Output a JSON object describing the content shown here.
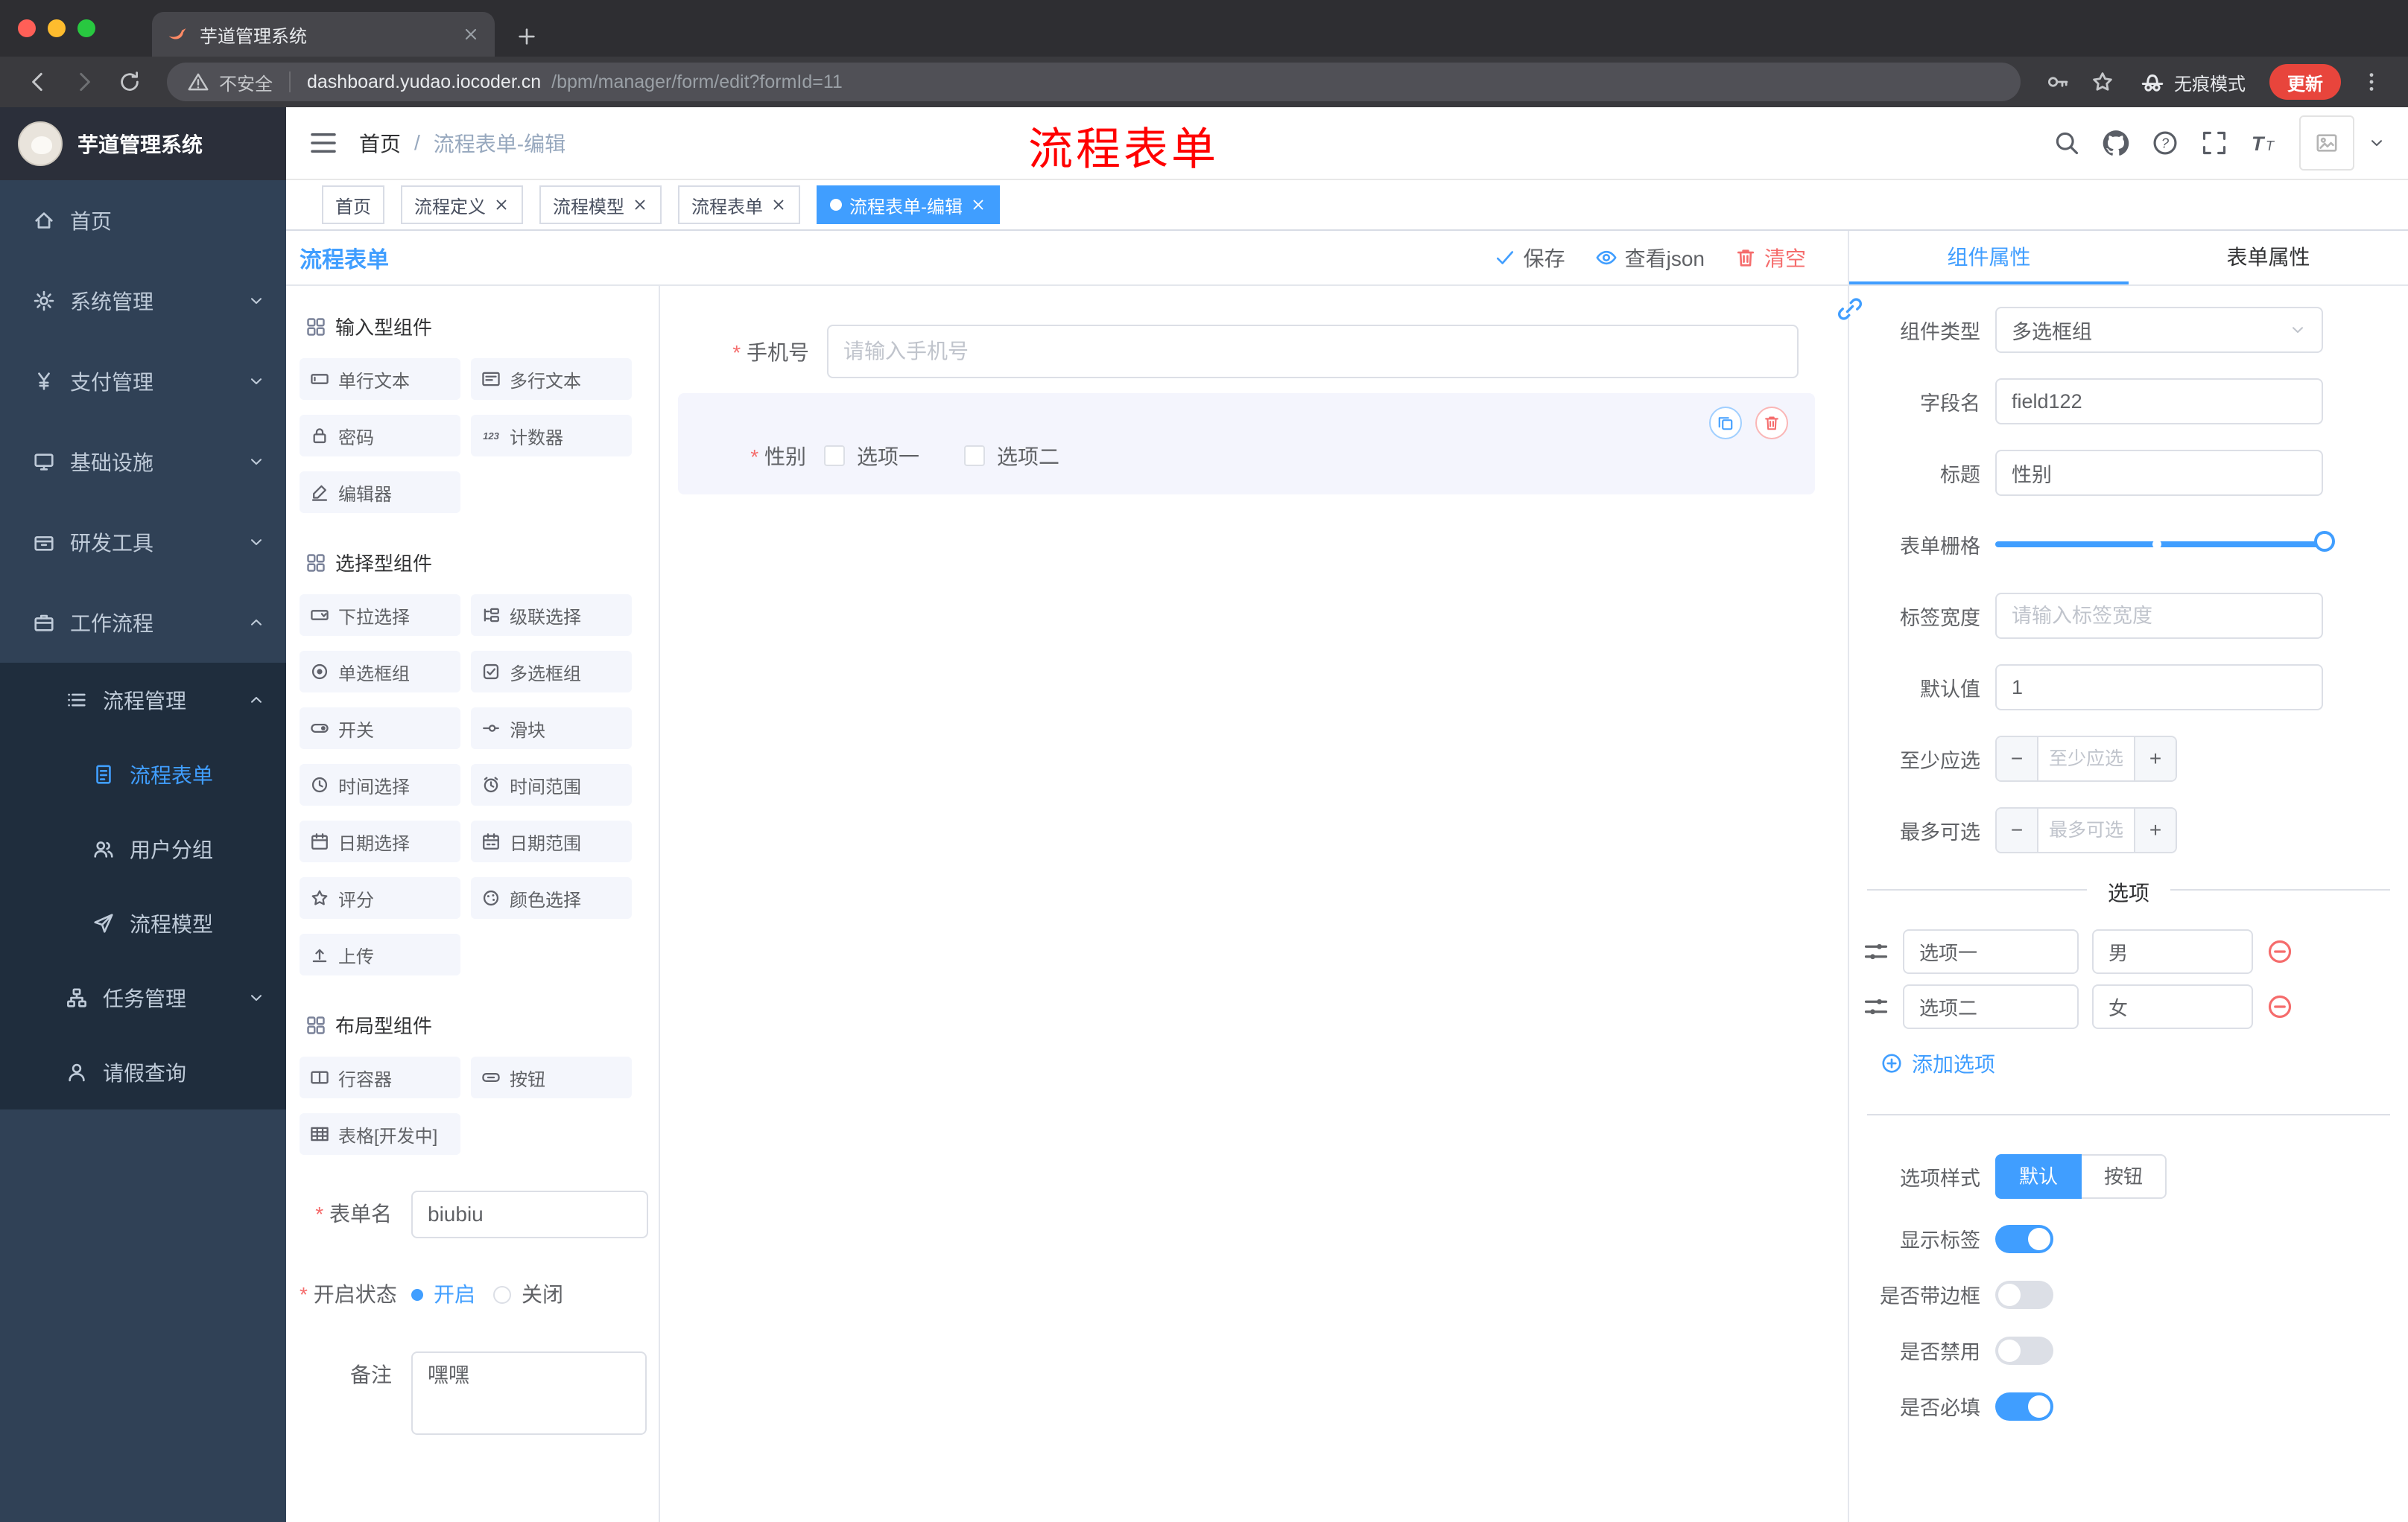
{
  "browser": {
    "tab_title": "芋道管理系统",
    "security_label": "不安全",
    "url_domain": "dashboard.yudao.iocoder.cn",
    "url_path": "/bpm/manager/form/edit?formId=11",
    "incognito_label": "无痕模式",
    "update_label": "更新"
  },
  "sidebar": {
    "logo_title": "芋道管理系统",
    "items": [
      {
        "label": "首页"
      },
      {
        "label": "系统管理"
      },
      {
        "label": "支付管理"
      },
      {
        "label": "基础设施"
      },
      {
        "label": "研发工具"
      },
      {
        "label": "工作流程"
      },
      {
        "label": "流程管理"
      },
      {
        "label": "流程表单"
      },
      {
        "label": "用户分组"
      },
      {
        "label": "流程模型"
      },
      {
        "label": "任务管理"
      },
      {
        "label": "请假查询"
      }
    ]
  },
  "header": {
    "breadcrumb_home": "首页",
    "breadcrumb_current": "流程表单-编辑",
    "annotation": "流程表单"
  },
  "tags": [
    {
      "label": "首页",
      "closable": false,
      "active": false
    },
    {
      "label": "流程定义",
      "closable": true,
      "active": false
    },
    {
      "label": "流程模型",
      "closable": true,
      "active": false
    },
    {
      "label": "流程表单",
      "closable": true,
      "active": false
    },
    {
      "label": "流程表单-编辑",
      "closable": true,
      "active": true
    }
  ],
  "designer": {
    "title": "流程表单",
    "toolbar": {
      "save": "保存",
      "view_json": "查看json",
      "clear": "清空"
    },
    "palette": {
      "sections": [
        {
          "title": "输入型组件",
          "items": [
            {
              "label": "单行文本",
              "icon": "text-input"
            },
            {
              "label": "多行文本",
              "icon": "textarea"
            },
            {
              "label": "密码",
              "icon": "lock"
            },
            {
              "label": "计数器",
              "icon": "counter"
            },
            {
              "label": "编辑器",
              "icon": "editor"
            }
          ]
        },
        {
          "title": "选择型组件",
          "items": [
            {
              "label": "下拉选择",
              "icon": "select"
            },
            {
              "label": "级联选择",
              "icon": "cascade"
            },
            {
              "label": "单选框组",
              "icon": "radio"
            },
            {
              "label": "多选框组",
              "icon": "checkbox"
            },
            {
              "label": "开关",
              "icon": "switch"
            },
            {
              "label": "滑块",
              "icon": "slider"
            },
            {
              "label": "时间选择",
              "icon": "time"
            },
            {
              "label": "时间范围",
              "icon": "time-range"
            },
            {
              "label": "日期选择",
              "icon": "date"
            },
            {
              "label": "日期范围",
              "icon": "date-range"
            },
            {
              "label": "评分",
              "icon": "star"
            },
            {
              "label": "颜色选择",
              "icon": "color"
            },
            {
              "label": "上传",
              "icon": "upload"
            }
          ]
        },
        {
          "title": "布局型组件",
          "items": [
            {
              "label": "行容器",
              "icon": "row"
            },
            {
              "label": "按钮",
              "icon": "button"
            },
            {
              "label": "表格[开发中]",
              "icon": "table"
            }
          ]
        }
      ]
    },
    "meta_form": {
      "form_name_label": "表单名",
      "form_name_value": "biubiu",
      "status_label": "开启状态",
      "status_on": "开启",
      "status_off": "关闭",
      "remark_label": "备注",
      "remark_value": "嘿嘿"
    },
    "canvas": {
      "phone_label": "手机号",
      "phone_placeholder": "请输入手机号",
      "gender_label": "性别",
      "gender_options": [
        "选项一",
        "选项二"
      ]
    }
  },
  "properties": {
    "tab_component": "组件属性",
    "tab_form": "表单属性",
    "rows": {
      "component_type_label": "组件类型",
      "component_type_value": "多选框组",
      "field_name_label": "字段名",
      "field_name_value": "field122",
      "title_label": "标题",
      "title_value": "性别",
      "grid_label": "表单栅格",
      "label_width_label": "标签宽度",
      "label_width_placeholder": "请输入标签宽度",
      "default_label": "默认值",
      "default_value": "1",
      "min_label": "至少应选",
      "min_placeholder": "至少应选",
      "max_label": "最多可选",
      "max_placeholder": "最多可选"
    },
    "options_title": "选项",
    "options": [
      {
        "label": "选项一",
        "value": "男"
      },
      {
        "label": "选项二",
        "value": "女"
      }
    ],
    "add_option_label": "添加选项",
    "style_label": "选项样式",
    "style_default": "默认",
    "style_button": "按钮",
    "show_label": "显示标签",
    "border_label": "是否带边框",
    "disabled_label": "是否禁用",
    "required_label": "是否必填"
  }
}
